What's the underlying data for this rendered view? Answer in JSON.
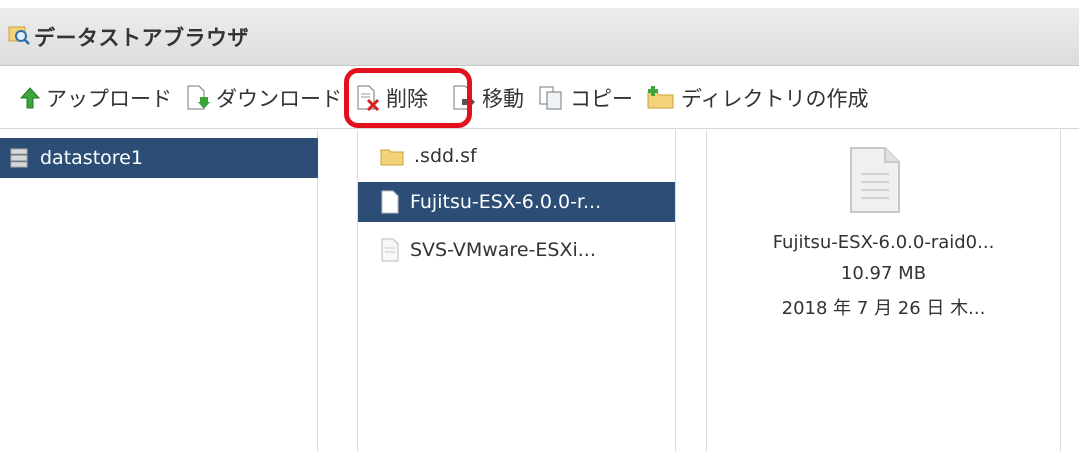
{
  "window": {
    "title": "データストアブラウザ"
  },
  "toolbar": {
    "upload": "アップロード",
    "download": "ダウンロード",
    "delete": "削除",
    "move": "移動",
    "copy": "コピー",
    "mkdir": "ディレクトリの作成"
  },
  "datastores": [
    {
      "label": "datastore1"
    }
  ],
  "files": [
    {
      "name": ".sdd.sf",
      "type": "folder"
    },
    {
      "name": "Fujitsu-ESX-6.0.0-r...",
      "type": "file",
      "selected": true
    },
    {
      "name": "SVS-VMware-ESXi...",
      "type": "file"
    }
  ],
  "preview": {
    "name": "Fujitsu-ESX-6.0.0-raid0...",
    "size": "10.97 MB",
    "date": "2018 年 7 月 26 日 木..."
  },
  "colors": {
    "selection": "#2b4d76",
    "highlight": "#e4101e"
  }
}
